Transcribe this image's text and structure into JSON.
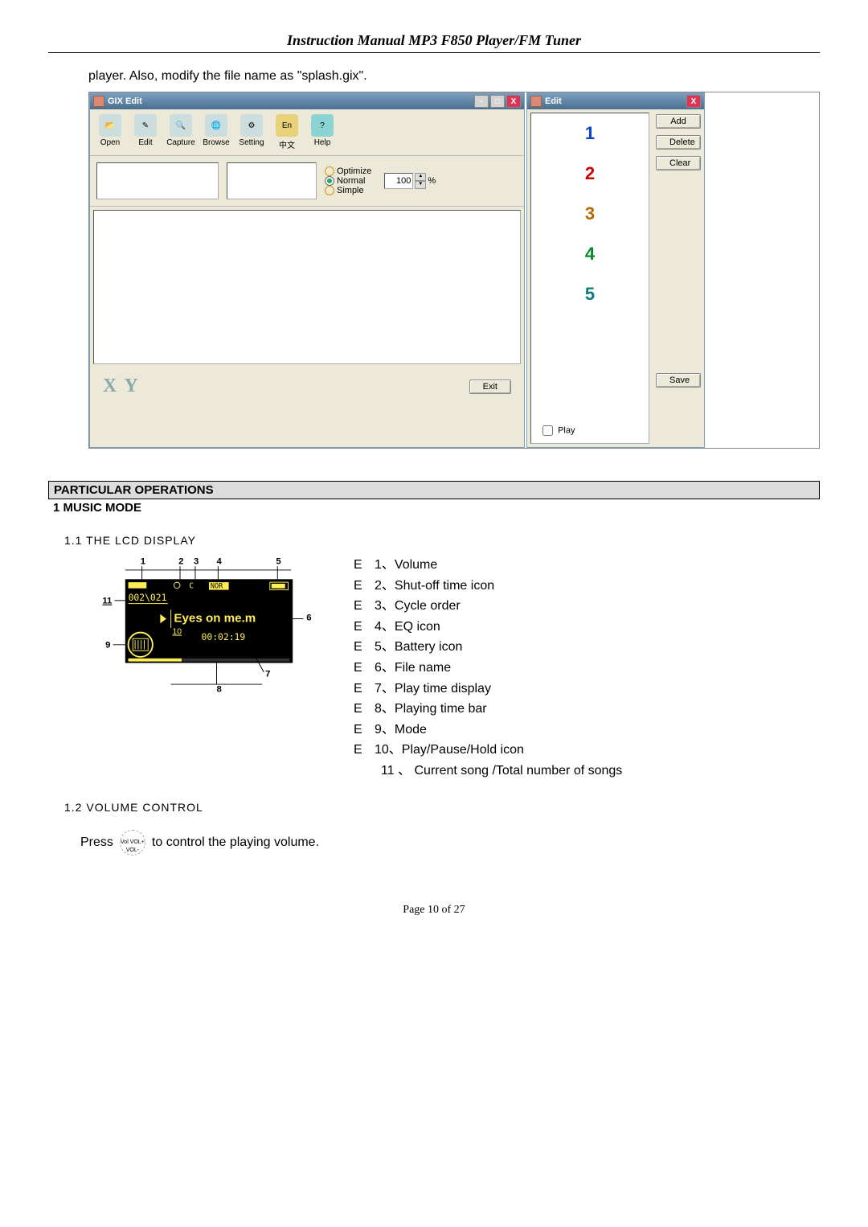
{
  "header_title": "Instruction Manual MP3 F850 Player/FM Tuner",
  "intro_text": "player.    Also, modify the file name as \"splash.gix\".",
  "gix": {
    "title": "GIX Edit",
    "winbtns": {
      "min": "-",
      "max": "□",
      "close": "X"
    },
    "toolbar": [
      {
        "label": "Open",
        "icon": "📂"
      },
      {
        "label": "Edit",
        "icon": "✎"
      },
      {
        "label": "Capture",
        "icon": "🔍"
      },
      {
        "label": "Browse",
        "icon": "🌐"
      },
      {
        "label": "Setting",
        "icon": "⚙"
      },
      {
        "label": "中文",
        "icon": "En"
      },
      {
        "label": "Help",
        "icon": "?"
      }
    ],
    "radios": {
      "optimize": "Optimize",
      "normal": "Normal",
      "simple": "Simple"
    },
    "spin_value": "100",
    "spin_unit": "%",
    "xy": "X Y",
    "exit": "Exit"
  },
  "edit": {
    "title": "Edit",
    "close": "X",
    "buttons": {
      "add": "Add",
      "delete": "Delete",
      "clear": "Clear",
      "save": "Save"
    },
    "list": [
      "1",
      "2",
      "3",
      "4",
      "5"
    ],
    "play": "Play"
  },
  "section": {
    "particular": "PARTICULAR OPERATIONS",
    "music_mode": "1    MUSIC MODE",
    "lcd_head": "1.1 THE LCD DISPLAY",
    "vol_head": "1.2 VOLUME CONTROL"
  },
  "lcd": {
    "labels": {
      "1": "1",
      "2": "2",
      "3": "3",
      "4": "4",
      "5": "5",
      "6": "6",
      "7": "7",
      "8": "8",
      "9": "9",
      "10": "10",
      "11": "11"
    },
    "screen": {
      "track_counter": "002\\021",
      "title": "Eyes on me.m",
      "time": "00:02:19",
      "nor": "NOR"
    }
  },
  "legend": [
    {
      "e": "E",
      "t": "1、Volume"
    },
    {
      "e": "E",
      "t": "2、Shut-off time icon"
    },
    {
      "e": "E",
      "t": "3、Cycle order"
    },
    {
      "e": "E",
      "t": "4、EQ icon"
    },
    {
      "e": "E",
      "t": "5、Battery icon"
    },
    {
      "e": "E",
      "t": "6、File name"
    },
    {
      "e": "E",
      "t": "7、Play time display"
    },
    {
      "e": "E",
      "t": "8、Playing time bar"
    },
    {
      "e": "E",
      "t": "9、Mode"
    },
    {
      "e": "E",
      "t": "10、Play/Pause/Hold icon"
    }
  ],
  "legend_tail": "11 、 Current  song  /Total number of songs",
  "vol_text_a": "Press",
  "vol_text_b": "to control the playing volume.",
  "vol_icon_text": "Vol\nVOL+ VOL-",
  "footer": "Page    10    of    27"
}
